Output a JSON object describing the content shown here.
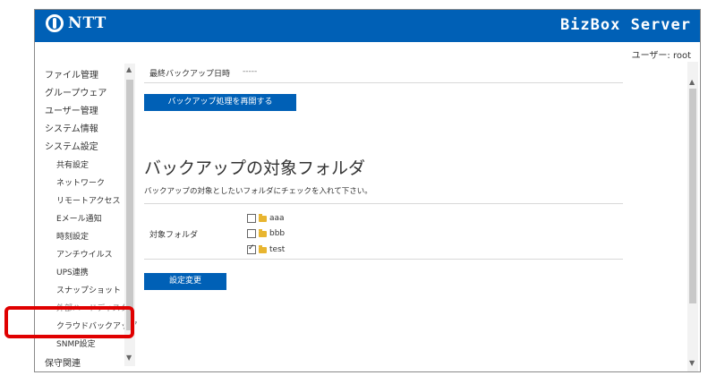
{
  "header": {
    "logo_text": "NTT",
    "product_name": "BizBox Server"
  },
  "user_label": "ユーザー: root",
  "sidebar": {
    "items": [
      {
        "label": "ファイル管理"
      },
      {
        "label": "グループウェア"
      },
      {
        "label": "ユーザー管理"
      },
      {
        "label": "システム情報"
      },
      {
        "label": "システム設定"
      }
    ],
    "sub_items": [
      {
        "label": "共有設定"
      },
      {
        "label": "ネットワーク"
      },
      {
        "label": "リモートアクセス"
      },
      {
        "label": "Eメール通知"
      },
      {
        "label": "時刻設定"
      },
      {
        "label": "アンチウイルス"
      },
      {
        "label": "UPS連携"
      },
      {
        "label": "スナップショット"
      },
      {
        "label": "外部ハードディスク"
      },
      {
        "label": "クラウドバックアップ"
      },
      {
        "label": "SNMP設定"
      }
    ],
    "bottom_item": "保守関連"
  },
  "main": {
    "last_backup_label": "最終バックアップ日時",
    "last_backup_value": "-----",
    "resume_button": "バックアップ処理を再開する",
    "section_title": "バックアップの対象フォルダ",
    "description": "バックアップの対象としたいフォルダにチェックを入れて下さい。",
    "target_label": "対象フォルダ",
    "folders": [
      {
        "name": "aaa",
        "checked": false
      },
      {
        "name": "bbb",
        "checked": false
      },
      {
        "name": "test",
        "checked": true
      }
    ],
    "apply_button": "設定変更"
  },
  "colors": {
    "brand": "#0060b6",
    "highlight": "#e00000"
  }
}
